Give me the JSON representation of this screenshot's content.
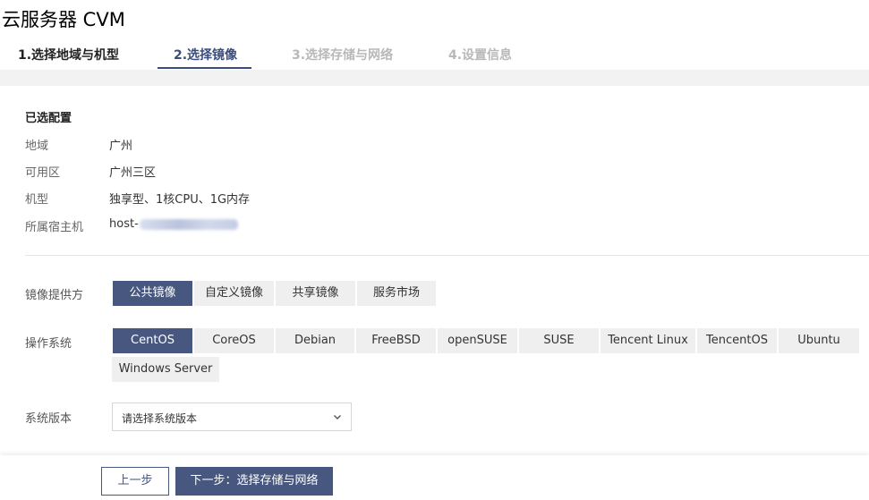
{
  "page_title": "云服务器 CVM",
  "steps": [
    {
      "label": "1.选择地域与机型",
      "state": "done"
    },
    {
      "label": "2.选择镜像",
      "state": "active"
    },
    {
      "label": "3.选择存储与网络",
      "state": "pending"
    },
    {
      "label": "4.设置信息",
      "state": "pending"
    }
  ],
  "selected_config": {
    "title": "已选配置",
    "rows": [
      {
        "label": "地域",
        "value": "广州"
      },
      {
        "label": "可用区",
        "value": "广州三区"
      },
      {
        "label": "机型",
        "value": "独享型、1核CPU、1G内存"
      },
      {
        "label": "所属宿主机",
        "value": "host-"
      }
    ]
  },
  "image_provider": {
    "label": "镜像提供方",
    "options": [
      "公共镜像",
      "自定义镜像",
      "共享镜像",
      "服务市场"
    ],
    "selected": "公共镜像"
  },
  "os": {
    "label": "操作系统",
    "options": [
      "CentOS",
      "CoreOS",
      "Debian",
      "FreeBSD",
      "openSUSE",
      "SUSE",
      "Tencent Linux",
      "TencentOS",
      "Ubuntu",
      "Windows Server"
    ],
    "selected": "CentOS"
  },
  "system_version": {
    "label": "系统版本",
    "placeholder": "请选择系统版本"
  },
  "footer": {
    "prev_label": "上一步",
    "next_label": "下一步：选择存储与网络"
  },
  "colors": {
    "accent": "#48577f",
    "step_active": "#3a4d7f",
    "segment_bg": "#efefef"
  }
}
